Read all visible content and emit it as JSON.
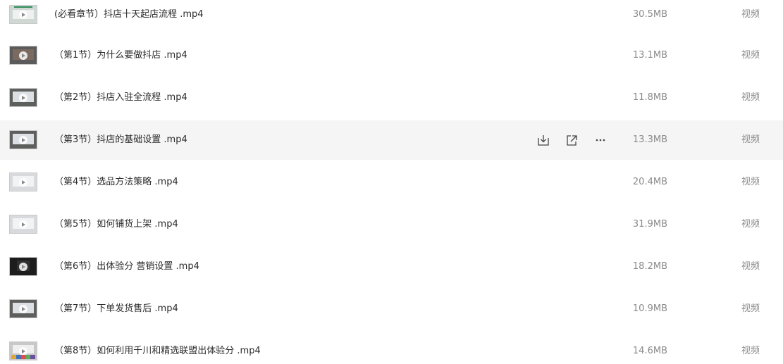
{
  "files": [
    {
      "name": "(必看章节）抖店十天起店流程 .mp4",
      "size": "30.5MB",
      "type": "视频",
      "thumb": "video-thumbnail"
    },
    {
      "name": "（第1节）为什么要做抖店 .mp4",
      "size": "13.1MB",
      "type": "视频",
      "thumb": "video-thumbnail"
    },
    {
      "name": "（第2节）抖店入驻全流程 .mp4",
      "size": "11.8MB",
      "type": "视频",
      "thumb": "video-thumbnail"
    },
    {
      "name": "（第3节）抖店的基础设置 .mp4",
      "size": "13.3MB",
      "type": "视频",
      "thumb": "video-thumbnail",
      "hovered": true
    },
    {
      "name": "（第4节）选品方法策略 .mp4",
      "size": "20.4MB",
      "type": "视频",
      "thumb": "video-thumbnail"
    },
    {
      "name": "（第5节）如何铺货上架 .mp4",
      "size": "31.9MB",
      "type": "视频",
      "thumb": "video-thumbnail"
    },
    {
      "name": "（第6节）出体验分 营销设置 .mp4",
      "size": "18.2MB",
      "type": "视频",
      "thumb": "video-thumbnail"
    },
    {
      "name": "（第7节）下单发货售后 .mp4",
      "size": "10.9MB",
      "type": "视频",
      "thumb": "video-thumbnail"
    },
    {
      "name": "（第8节）如何利用千川和精选联盟出体验分 .mp4",
      "size": "14.6MB",
      "type": "视频",
      "thumb": "video-thumbnail"
    }
  ],
  "row_actions": {
    "icons": [
      "download-icon",
      "share-icon",
      "more-icon"
    ]
  },
  "colors": {
    "hover_background": "#f5f5f6",
    "text_primary": "#2b2b2b",
    "text_secondary": "#8a8a8a",
    "icon": "#444444"
  }
}
